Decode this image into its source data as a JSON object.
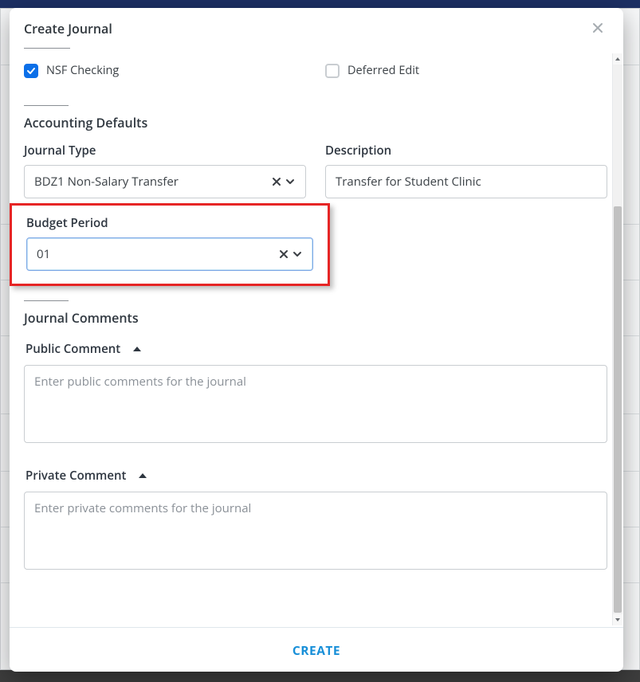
{
  "modal": {
    "title": "Create Journal"
  },
  "options": {
    "nsf_checking_label": "NSF Checking",
    "deferred_edit_label": "Deferred Edit"
  },
  "accounting_defaults": {
    "section_title": "Accounting Defaults",
    "journal_type": {
      "label": "Journal Type",
      "value": "BDZ1 Non-Salary Transfer"
    },
    "description": {
      "label": "Description",
      "value": "Transfer for Student Clinic"
    },
    "budget_period": {
      "label": "Budget Period",
      "value": "01"
    }
  },
  "journal_comments": {
    "section_title": "Journal Comments",
    "public": {
      "label": "Public Comment",
      "placeholder": "Enter public comments for the journal"
    },
    "private": {
      "label": "Private Comment",
      "placeholder": "Enter private comments for the journal"
    }
  },
  "footer": {
    "create_label": "CREATE"
  },
  "icons": {
    "close": "close-icon",
    "clear": "clear-x-icon",
    "chevron_down": "chevron-down-icon",
    "caret_up": "caret-up-icon",
    "scroll_up": "scroll-up-arrow-icon",
    "scroll_down": "scroll-down-arrow-icon"
  },
  "colors": {
    "accent_blue": "#0b6fe8",
    "create_blue": "#188fd8",
    "highlight_red": "#e62525",
    "header_bar": "#1c2f63"
  }
}
